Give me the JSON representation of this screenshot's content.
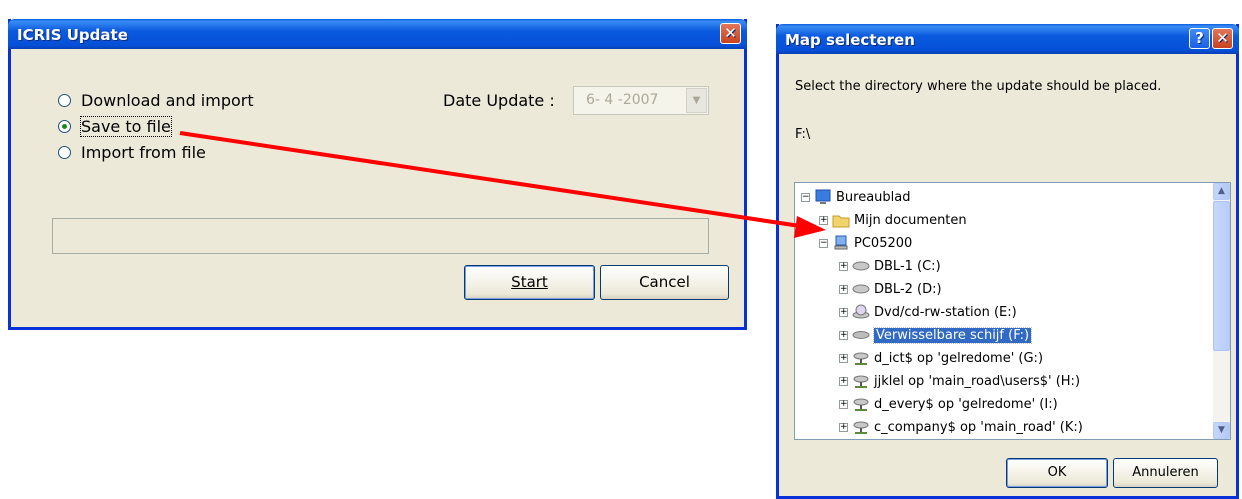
{
  "icris_dialog": {
    "title": "ICRIS Update",
    "options": [
      {
        "label": "Download and import",
        "selected": false
      },
      {
        "label": "Save to file",
        "selected": true
      },
      {
        "label": "Import from file",
        "selected": false
      }
    ],
    "date_label": "Date Update :",
    "date_value": "6- 4 -2007",
    "start_label": "Start",
    "cancel_label": "Cancel"
  },
  "folder_dialog": {
    "title": "Map selecteren",
    "instruction": "Select the directory where the update should be placed.",
    "path": "F:\\",
    "tree": [
      {
        "label": "Bureaublad",
        "icon": "desktop-icon",
        "expander": "−"
      },
      {
        "label": "Mijn documenten",
        "icon": "folder-icon",
        "expander": "+"
      },
      {
        "label": "PC05200",
        "icon": "computer-icon",
        "expander": "−"
      },
      {
        "label": "DBL-1 (C:)",
        "icon": "drive-icon",
        "expander": "+"
      },
      {
        "label": "DBL-2 (D:)",
        "icon": "drive-icon",
        "expander": "+"
      },
      {
        "label": "Dvd/cd-rw-station (E:)",
        "icon": "cd-drive-icon",
        "expander": "+"
      },
      {
        "label": "Verwisselbare schijf (F:)",
        "icon": "removable-drive-icon",
        "expander": "+",
        "selected": true
      },
      {
        "label": "d_ict$ op 'gelredome' (G:)",
        "icon": "network-drive-icon",
        "expander": "+"
      },
      {
        "label": "jjklel op 'main_road\\users$' (H:)",
        "icon": "network-drive-icon",
        "expander": "+"
      },
      {
        "label": "d_every$ op 'gelredome' (I:)",
        "icon": "network-drive-icon",
        "expander": "+"
      },
      {
        "label": "c_company$ op 'main_road' (K:)",
        "icon": "network-drive-icon",
        "expander": "+"
      }
    ],
    "ok_label": "OK",
    "cancel_label": "Annuleren"
  },
  "colors": {
    "arrow": "#ff0000",
    "selection": "#316ac5",
    "titlebar": "#0a5ade"
  }
}
